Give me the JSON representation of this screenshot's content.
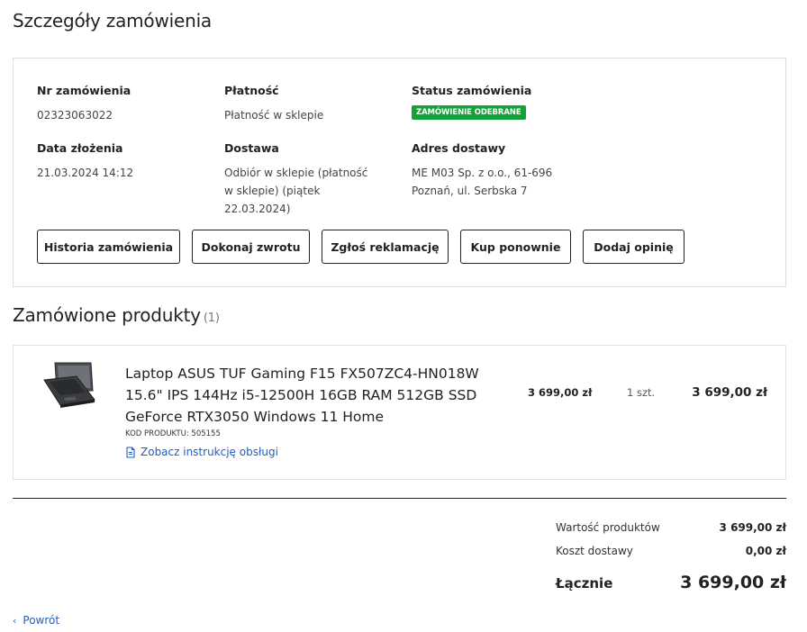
{
  "page": {
    "title": "Szczegóły zamówienia"
  },
  "order": {
    "number_label": "Nr zamówienia",
    "number_value": "02323063022",
    "payment_label": "Płatność",
    "payment_value": "Płatność w sklepie",
    "status_label": "Status zamówienia",
    "status_value": "ZAMÓWIENIE ODEBRANE",
    "date_label": "Data złożenia",
    "date_value": "21.03.2024 14:12",
    "delivery_label": "Dostawa",
    "delivery_value": "Odbiór w sklepie (płatność w sklepie) (piątek 22.03.2024)",
    "address_label": "Adres dostawy",
    "address_line1": "ME M03 Sp. z o.o., 61-696",
    "address_line2": "Poznań, ul. Serbska 7"
  },
  "actions": {
    "history": "Historia zamówienia",
    "return": "Dokonaj zwrotu",
    "complaint": "Zgłoś reklamację",
    "buy_again": "Kup ponownie",
    "review": "Dodaj opinię"
  },
  "products_section": {
    "title": "Zamówione produkty",
    "count": "(1)"
  },
  "product": {
    "name": "Laptop ASUS TUF Gaming F15 FX507ZC4-HN018W 15.6\" IPS 144Hz i5-12500H 16GB RAM 512GB SSD GeForce RTX3050 Windows 11 Home",
    "code": "KOD PRODUKTU: 505155",
    "manual_link": "Zobacz instrukcję obsługi",
    "unit_price": "3 699,00 zł",
    "quantity": "1 szt.",
    "line_total": "3 699,00 zł",
    "image_icon": "laptop-icon"
  },
  "summary": {
    "products_label": "Wartość produktów",
    "products_value": "3 699,00 zł",
    "shipping_label": "Koszt dostawy",
    "shipping_value": "0,00 zł",
    "total_label": "Łącznie",
    "total_value": "3 699,00 zł"
  },
  "nav": {
    "back_label": "Powrót",
    "back_icon": "chevron-left-icon"
  },
  "colors": {
    "status_badge": "#14a03a",
    "link": "#1f5fbf",
    "border": "#dcdcdc"
  }
}
